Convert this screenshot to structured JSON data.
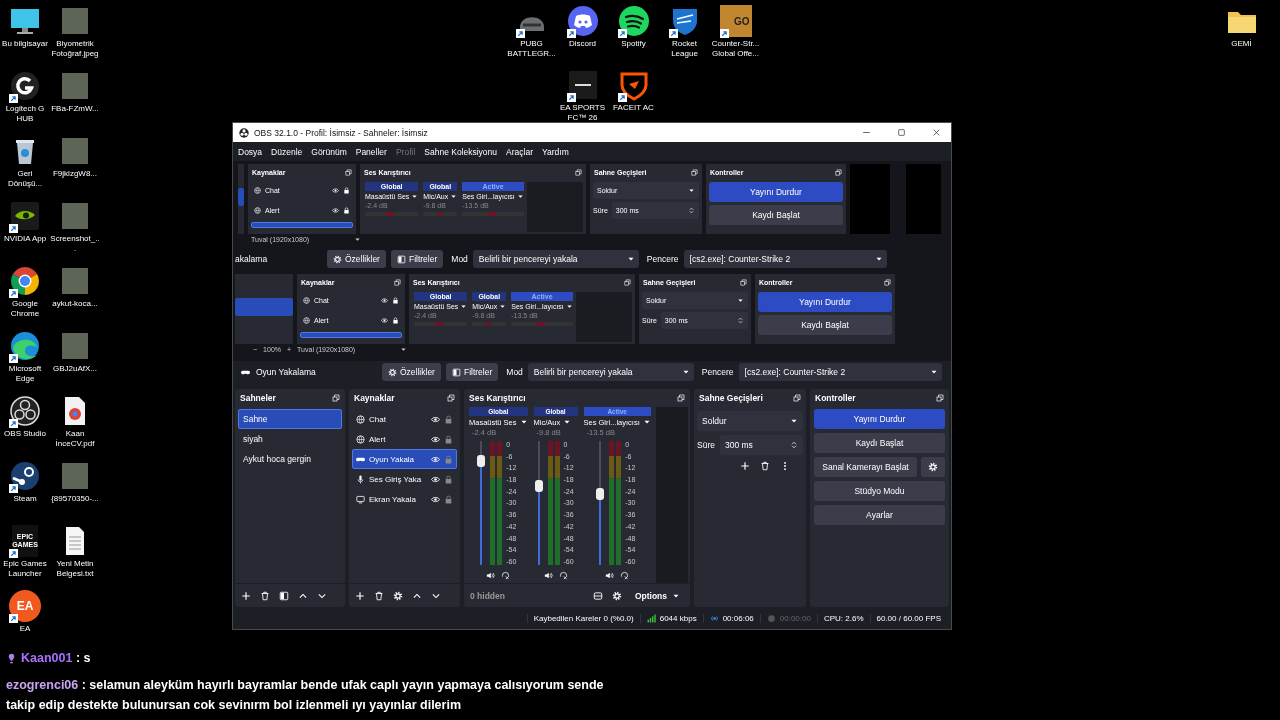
{
  "desktop": {
    "left_icons": [
      {
        "label": "Bu bilgisayar",
        "kind": "pc",
        "shortcut": false
      },
      {
        "label": "Biyometrik Fotoğraf.jpeg",
        "kind": "photo",
        "shortcut": false
      },
      {
        "label": "Logitech G HUB",
        "kind": "ghub",
        "shortcut": true
      },
      {
        "label": "FBa-FZmW...",
        "kind": "photo",
        "shortcut": false
      },
      {
        "label": "Geri Dönüşü...",
        "kind": "bin",
        "shortcut": false
      },
      {
        "label": "F9jklzgW8...",
        "kind": "photo",
        "shortcut": false
      },
      {
        "label": "NVIDIA App",
        "kind": "nvidia",
        "shortcut": true
      },
      {
        "label": "Screenshot_...",
        "kind": "photo",
        "shortcut": false
      },
      {
        "label": "Google Chrome",
        "kind": "chrome",
        "shortcut": true
      },
      {
        "label": "aykut-koca...",
        "kind": "photo",
        "shortcut": false
      },
      {
        "label": "Microsoft Edge",
        "kind": "edge",
        "shortcut": true
      },
      {
        "label": "GBJ2uAfX...",
        "kind": "photo",
        "shortcut": false
      },
      {
        "label": "OBS Studio",
        "kind": "obs",
        "shortcut": true
      },
      {
        "label": "Kaan İnceCV.pdf",
        "kind": "pdf",
        "shortcut": false
      },
      {
        "label": "Steam",
        "kind": "steam",
        "shortcut": true
      },
      {
        "label": "{89570350-...",
        "kind": "photo",
        "shortcut": false
      },
      {
        "label": "Epic Games Launcher",
        "kind": "epic",
        "shortcut": true,
        "logo_text": "EPIC GAMES"
      },
      {
        "label": "Yeni Metin Belgesi.txt",
        "kind": "txt",
        "shortcut": false
      },
      {
        "label": "EA",
        "kind": "ea",
        "shortcut": true,
        "logo_text": "EA"
      }
    ],
    "top_icons": [
      {
        "label": "PUBG BATTLEGR...",
        "kind": "pubg",
        "shortcut": true
      },
      {
        "label": "Discord",
        "kind": "discord",
        "shortcut": true
      },
      {
        "label": "Spotify",
        "kind": "spotify",
        "shortcut": true
      },
      {
        "label": "Rocket League",
        "kind": "rocket",
        "shortcut": true
      },
      {
        "label": "Counter-Str... Global Offe...",
        "kind": "csgo",
        "shortcut": true,
        "logo_text": "GO"
      }
    ],
    "second_row_icons": [
      {
        "label": "EA SPORTS FC™ 26",
        "kind": "fc",
        "shortcut": true
      },
      {
        "label": "FACEIT AC",
        "kind": "faceit",
        "shortcut": true
      }
    ],
    "right_icons": [
      {
        "label": "GEMİ",
        "kind": "folder",
        "shortcut": false
      }
    ]
  },
  "obs": {
    "title": "OBS 32.1.0 - Profil: İsimsiz - Sahneler: İsimsiz",
    "menu": [
      {
        "label": "Dosya",
        "disabled": false
      },
      {
        "label": "Düzenle",
        "disabled": false
      },
      {
        "label": "Görünüm",
        "disabled": false
      },
      {
        "label": "Paneller",
        "disabled": false
      },
      {
        "label": "Profil",
        "disabled": true
      },
      {
        "label": "Sahne Koleksiyonu",
        "disabled": false
      },
      {
        "label": "Araçlar",
        "disabled": false
      },
      {
        "label": "Yardım",
        "disabled": false
      }
    ],
    "preview": {
      "copies": [
        {
          "sources_title": "Kaynaklar",
          "sources": [
            {
              "name": "Chat",
              "kind": "browser"
            },
            {
              "name": "Alert",
              "kind": "browser"
            }
          ],
          "mixer_title": "Ses Karıştırıcı",
          "channels": [
            {
              "scope": "Global",
              "active": false,
              "name": "Masaüstü Ses",
              "db": "-2.4 dB"
            },
            {
              "scope": "Global",
              "active": false,
              "name": "Mic/Aux",
              "db": "-9.8 dB"
            },
            {
              "scope": "Active",
              "active": true,
              "name": "Ses Giri...layıcısı",
              "db": "-13.5 dB"
            }
          ],
          "transitions_title": "Sahne Geçişleri",
          "transition": "Soldur",
          "duration_label": "Süre",
          "duration": "300 ms",
          "controls_title": "Kontroller",
          "controls": [
            {
              "label": "Yayını Durdur",
              "kind": "primary"
            },
            {
              "label": "Kaydı Başlat",
              "kind": "plain"
            }
          ],
          "canvas": "Tuval (1920x1080)",
          "toolbar": {
            "source": "akalama",
            "properties": "Özellikler",
            "filters": "Filtreler",
            "mode_label": "Mod",
            "mode": "Belirli bir pencereyi yakala",
            "window_label": "Pencere",
            "window": "[cs2.exe]: Counter-Strike 2"
          }
        },
        {
          "sources_title": "Kaynaklar",
          "sources": [
            {
              "name": "Chat",
              "kind": "browser"
            },
            {
              "name": "Alert",
              "kind": "browser"
            }
          ],
          "mixer_title": "Ses Karıştırıcı",
          "channels": [
            {
              "scope": "Global",
              "active": false,
              "name": "Masaüstü Ses",
              "db": "-2.4 dB"
            },
            {
              "scope": "Global",
              "active": false,
              "name": "Mic/Aux",
              "db": "-9.8 dB"
            },
            {
              "scope": "Active",
              "active": true,
              "name": "Ses Giri...layıcısı",
              "db": "-13.5 dB"
            }
          ],
          "transitions_title": "Sahne Geçişleri",
          "transition": "Soldur",
          "duration_label": "Süre",
          "duration": "300 ms",
          "controls_title": "Kontroller",
          "controls": [
            {
              "label": "Yayını Durdur",
              "kind": "primary"
            },
            {
              "label": "Kaydı Başlat",
              "kind": "plain"
            }
          ],
          "zoom_out": "−",
          "zoom": "100%",
          "zoom_in": "+",
          "canvas": "Tuval (1920x1080)"
        }
      ]
    },
    "source_toolbar": {
      "source": "Oyun Yakalama",
      "kind": "game",
      "properties": "Özellikler",
      "filters": "Filtreler",
      "mode_label": "Mod",
      "mode": "Belirli bir pencereyi yakala",
      "window_label": "Pencere",
      "window": "[cs2.exe]: Counter-Strike 2"
    },
    "scenes": {
      "title": "Sahneler",
      "items": [
        {
          "name": "Sahne",
          "selected": true
        },
        {
          "name": "siyah",
          "selected": false
        },
        {
          "name": "Aykut hoca gergin",
          "selected": false
        }
      ]
    },
    "sources": {
      "title": "Kaynaklar",
      "items": [
        {
          "name": "Chat",
          "kind": "browser",
          "selected": false
        },
        {
          "name": "Alert",
          "kind": "browser",
          "selected": false
        },
        {
          "name": "Oyun Yakala",
          "kind": "game",
          "selected": true
        },
        {
          "name": "Ses Giriş Yaka",
          "kind": "audio_input",
          "selected": false
        },
        {
          "name": "Ekran Yakala",
          "kind": "display",
          "selected": false
        }
      ]
    },
    "mixer": {
      "title": "Ses Karıştırıcı",
      "channels": [
        {
          "scope": "Global",
          "active": false,
          "name": "Masaüstü Ses",
          "db": "-2.4 dB",
          "level": 0.84,
          "scale": [
            "0",
            "-6",
            "-12",
            "-18",
            "-24",
            "-30",
            "-36",
            "-42",
            "-48",
            "-54",
            "-60"
          ]
        },
        {
          "scope": "Global",
          "active": false,
          "name": "Mic/Aux",
          "db": "-9.8 dB",
          "level": 0.64,
          "scale": [
            "0",
            "-6",
            "-12",
            "-18",
            "-24",
            "-30",
            "-36",
            "-42",
            "-48",
            "-54",
            "-60"
          ]
        },
        {
          "scope": "Active",
          "active": true,
          "name": "Ses Giri...layıcısı",
          "db": "-13.5 dB",
          "level": 0.57,
          "scale": [
            "0",
            "-6",
            "-12",
            "-18",
            "-24",
            "-30",
            "-36",
            "-42",
            "-48",
            "-54",
            "-60"
          ]
        }
      ],
      "hidden": "0 hidden",
      "options": "Options"
    },
    "transitions": {
      "title": "Sahne Geçişleri",
      "transition": "Soldur",
      "duration_label": "Süre",
      "duration": "300 ms"
    },
    "controls": {
      "title": "Kontroller",
      "buttons": [
        {
          "label": "Yayını Durdur",
          "kind": "primary"
        },
        {
          "label": "Kaydı Başlat",
          "kind": "plain"
        },
        {
          "label": "Sanal Kamerayı Başlat",
          "kind": "with_settings"
        },
        {
          "label": "Stüdyo Modu",
          "kind": "plain"
        },
        {
          "label": "Ayarlar",
          "kind": "plain"
        }
      ]
    },
    "status_bar": {
      "dropped": "Kaybedilen Kareler 0 (%0.0)",
      "bitrate": "6044 kbps",
      "stream_time": "00:06:06",
      "recording": false,
      "record_time": "00:00:00",
      "cpu": "CPU: 2.6%",
      "fps": "60.00 / 60.00 FPS"
    }
  },
  "chat": {
    "messages": [
      {
        "user": "Kaan001",
        "color": "#a970ff",
        "badge": true,
        "text": ": s"
      },
      {
        "user": "ezogrenci06",
        "color": "#c9a4f2",
        "badge": false,
        "text": ": selamun aleyküm hayırlı bayramlar bende ufak caplı yayın yapmaya calısıyorum sende takip edip destekte bulunursan cok sevinırm bol izlenmeli ıyı yayınlar dilerim"
      }
    ]
  }
}
